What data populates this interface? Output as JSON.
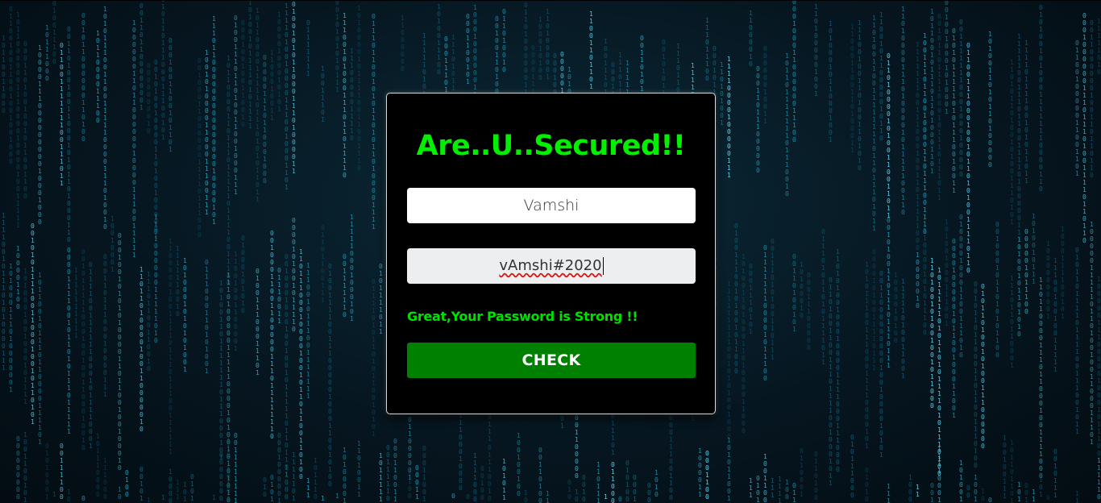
{
  "page": {
    "background": "matrix-binary-rain",
    "accent_color": "#00f000",
    "button_color": "#008000"
  },
  "form": {
    "title": "Are..U..Secured!!",
    "username_value": "Vamshi",
    "password_value": "vAmshi#2020",
    "status_message": "Great,Your Password is Strong !!",
    "check_label": "CHECK"
  }
}
